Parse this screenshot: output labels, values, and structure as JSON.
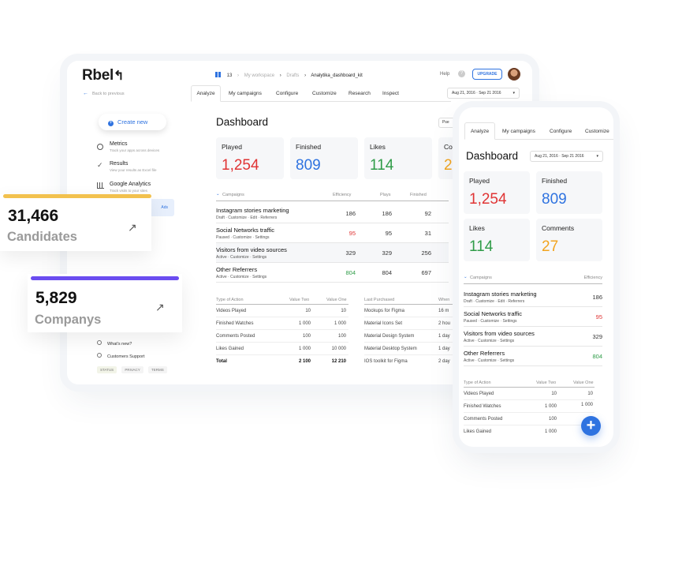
{
  "desktop": {
    "logo": "Rbel",
    "breadcrumb": {
      "count": "13",
      "workspace": "My workspace",
      "drafts": "Drafts",
      "current": "Analytika_dashboard_kit"
    },
    "help": "Help",
    "upgrade": "UPGRADE",
    "back": "Back to previous",
    "tabs": [
      "Analyze",
      "My campaigns",
      "Configure",
      "Customize",
      "Research",
      "Inspect"
    ],
    "date_range": "Aug 21, 2016 · Sep 21 2016",
    "create_new": "Create new",
    "sidebar": [
      {
        "title": "Metrics",
        "sub": "Track your apps across devices"
      },
      {
        "title": "Results",
        "sub": "View your results as Excel file"
      },
      {
        "title": "Google Analytics",
        "sub": "Track visits to your sites"
      }
    ],
    "sidebar_pill": "Ads",
    "whats_new": "What's new?",
    "support": "Customers Support",
    "footer_links": [
      "STATUS",
      "PRIVACY",
      "TERMS"
    ],
    "title": "Dashboard",
    "right_btn": "Pse",
    "kpis": [
      {
        "label": "Played",
        "value": "1,254"
      },
      {
        "label": "Finished",
        "value": "809"
      },
      {
        "label": "Likes",
        "value": "114"
      },
      {
        "label": "Co",
        "value": "2"
      }
    ],
    "campaign_head": [
      "Campaigns",
      "Efficiency",
      "Plays",
      "Finished"
    ],
    "campaigns": [
      {
        "name": "Instagram stories marketing",
        "sub": "Draft · Customize · Edit · Referrers",
        "eff": "186",
        "plays": "186",
        "fin": "92"
      },
      {
        "name": "Social Networks traffic",
        "sub": "Paused · Customize · Settings",
        "eff": "95",
        "plays": "95",
        "fin": "31"
      },
      {
        "name": "Visitors from video sources",
        "sub": "Active · Customize · Settings",
        "eff": "329",
        "plays": "329",
        "fin": "256"
      },
      {
        "name": "Other Referrers",
        "sub": "Active · Customize · Settings",
        "eff": "804",
        "plays": "804",
        "fin": "697"
      }
    ],
    "action_head": [
      "Type of Action",
      "Value Two",
      "Value One"
    ],
    "actions": [
      [
        "Videos Played",
        "10",
        "10"
      ],
      [
        "Finished Watches",
        "1 000",
        "1 000"
      ],
      [
        "Comments Posted",
        "100",
        "100"
      ],
      [
        "Likes Gained",
        "1 000",
        "10 000"
      ],
      [
        "Total",
        "2 100",
        "12 210"
      ]
    ],
    "purchase_head": [
      "Last Purchased",
      "When"
    ],
    "purchases": [
      [
        "Mockups for Figma",
        "16 m"
      ],
      [
        "Material Icons Set",
        "2 hou"
      ],
      [
        "Material Design System",
        "1 day"
      ],
      [
        "Material Desktop System",
        "1 day"
      ],
      [
        "IOS toolkit for Figma",
        "2 day"
      ]
    ]
  },
  "overlays": {
    "candidates": {
      "value": "31,466",
      "label": "Candidates",
      "bar_color": "#f2c14e"
    },
    "companys": {
      "value": "5,829",
      "label": "Companys",
      "bar_color": "#6a4cf0"
    }
  },
  "mobile": {
    "tabs": [
      "Analyze",
      "My campaigns",
      "Configure",
      "Customize"
    ],
    "title": "Dashboard",
    "date_range": "Aug 21, 2016 · Sep 21 2016",
    "kpis": [
      {
        "label": "Played",
        "value": "1,254"
      },
      {
        "label": "Finished",
        "value": "809"
      },
      {
        "label": "Likes",
        "value": "114"
      },
      {
        "label": "Comments",
        "value": "27"
      }
    ],
    "campaign_head": [
      "Campaigns",
      "Efficiency"
    ],
    "campaigns": [
      {
        "name": "Instagram stories marketing",
        "sub": "Draft · Customize · Edit · Referrers",
        "eff": "186"
      },
      {
        "name": "Social Networks traffic",
        "sub": "Paused · Customize · Settings",
        "eff": "95"
      },
      {
        "name": "Visitors from video sources",
        "sub": "Active · Customize · Settings",
        "eff": "329"
      },
      {
        "name": "Other Referrers",
        "sub": "Active · Customize · Settings",
        "eff": "804"
      }
    ],
    "action_head": [
      "Type of Action",
      "Value Two",
      "Value One"
    ],
    "actions": [
      [
        "Videos Played",
        "10",
        "10"
      ],
      [
        "Finished Watches",
        "1 000",
        "1 000"
      ],
      [
        "Comments Posted",
        "100",
        ""
      ],
      [
        "Likes Gained",
        "1 000",
        ""
      ]
    ]
  },
  "colors": {
    "accent": "#2f73e0",
    "red": "#e03434",
    "green": "#2f9c48",
    "orange": "#f2a41f"
  }
}
